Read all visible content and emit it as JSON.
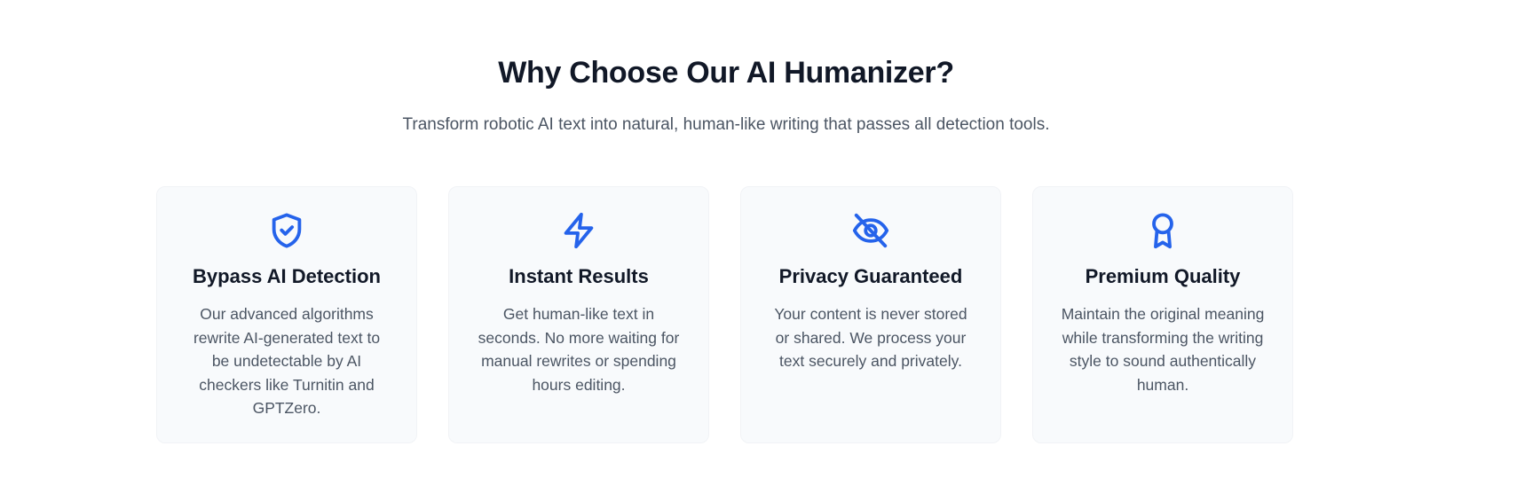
{
  "section": {
    "title": "Why Choose Our AI Humanizer?",
    "subtitle": "Transform robotic AI text into natural, human-like writing that passes all detection tools."
  },
  "theme": {
    "accent": "#2563eb",
    "title_color": "#111827",
    "text_color": "#4b5563",
    "card_background": "#f8fafc"
  },
  "features": [
    {
      "icon": "shield-check-icon",
      "title": "Bypass AI Detection",
      "text": "Our advanced algorithms rewrite AI-generated text to be undetectable by AI checkers like Turnitin and GPTZero."
    },
    {
      "icon": "lightning-bolt-icon",
      "title": "Instant Results",
      "text": "Get human-like text in seconds. No more waiting for manual rewrites or spending hours editing."
    },
    {
      "icon": "eye-off-icon",
      "title": "Privacy Guaranteed",
      "text": "Your content is never stored or shared. We process your text securely and privately."
    },
    {
      "icon": "award-ribbon-icon",
      "title": "Premium Quality",
      "text": "Maintain the original meaning while transforming the writing style to sound authentically human."
    }
  ]
}
